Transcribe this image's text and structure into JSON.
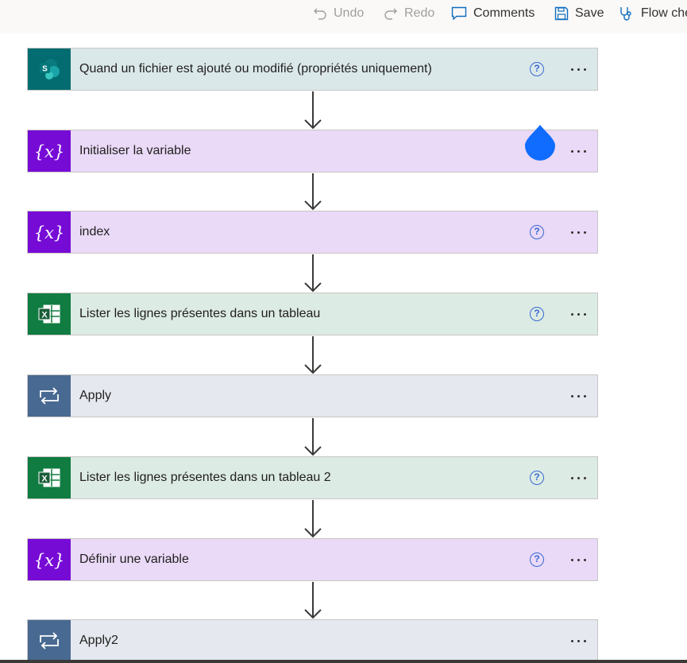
{
  "toolbar": {
    "undo_label": "Undo",
    "redo_label": "Redo",
    "comments_label": "Comments",
    "save_label": "Save",
    "flow_checker_label": "Flow checker"
  },
  "flow": {
    "steps": [
      {
        "title": "Quand un fichier est ajouté ou modifié (propriétés uniquement)",
        "icon": "sharepoint-icon",
        "help": "?"
      },
      {
        "title": "Initialiser la variable",
        "icon": "variable-icon",
        "help": "?"
      },
      {
        "title": "index",
        "icon": "variable-icon",
        "help": "?"
      },
      {
        "title": "Lister les lignes présentes dans un tableau",
        "icon": "excel-icon",
        "help": "?"
      },
      {
        "title": "Apply",
        "icon": "loop-icon"
      },
      {
        "title": "Lister les lignes présentes dans un tableau 2",
        "icon": "excel-icon",
        "help": "?"
      },
      {
        "title": "Définir une variable",
        "icon": "variable-icon",
        "help": "?"
      },
      {
        "title": "Apply2",
        "icon": "loop-icon"
      }
    ]
  },
  "colors": {
    "sharepoint": "#036c70",
    "variable": "#770bd6",
    "excel": "#107c41",
    "loop": "#486991",
    "accent": "#0f6cbd"
  }
}
